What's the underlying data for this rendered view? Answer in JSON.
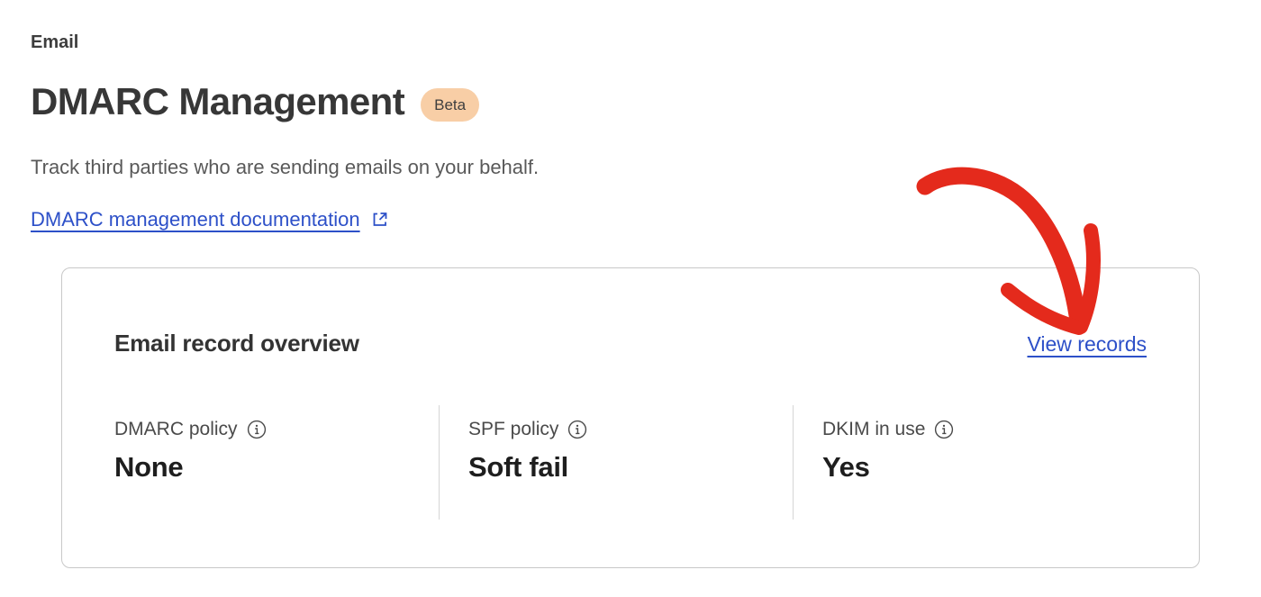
{
  "page": {
    "breadcrumb": "Email",
    "title": "DMARC Management",
    "beta_badge": "Beta",
    "subtitle": "Track third parties who are sending emails on your behalf.",
    "doc_link_label": "DMARC management documentation"
  },
  "card": {
    "title": "Email record overview",
    "view_records_label": "View records",
    "stats": [
      {
        "label": "DMARC policy",
        "value": "None"
      },
      {
        "label": "SPF policy",
        "value": "Soft fail"
      },
      {
        "label": "DKIM in use",
        "value": "Yes"
      }
    ]
  },
  "icons": {
    "external_link": "external-link-icon",
    "info": "info-icon",
    "annotation_arrow": "red-hand-drawn-arrow"
  },
  "colors": {
    "link_blue": "#2D50C8",
    "badge_bg": "#F8CEA6",
    "badge_text": "#3F3F3F",
    "arrow_red": "#E42A1C",
    "card_border": "#C8C8C8",
    "heading_text": "#373737",
    "subtitle_text": "#595959",
    "value_text": "#1E1E1E"
  }
}
